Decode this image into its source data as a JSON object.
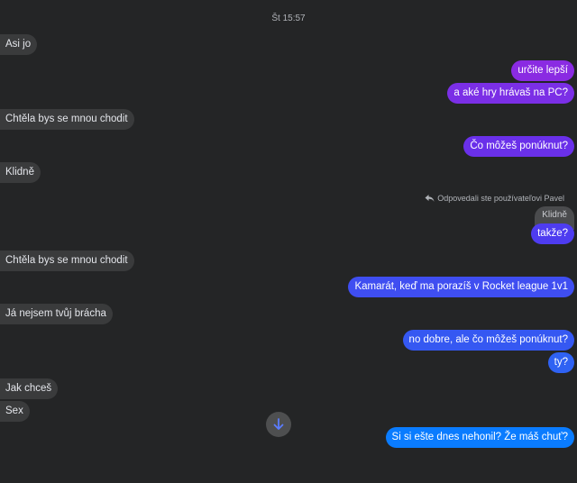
{
  "timestamp": "Št 15:57",
  "messages": [
    {
      "dir": "in",
      "text": "Asi jo"
    },
    {
      "dir": "out",
      "text": "určite lepší",
      "color": "#8a2be2"
    },
    {
      "dir": "out",
      "text": "a aké hry hrávaš na PC?",
      "color": "#7b2fe6"
    },
    {
      "dir": "in",
      "text": "Chtěla bys se mnou chodit"
    },
    {
      "dir": "out",
      "text": "Čo môžeš ponúknut?",
      "color": "#6a30ea"
    },
    {
      "dir": "in",
      "text": "Klidně"
    },
    {
      "dir": "out",
      "text": "takže?",
      "color": "#4e3cf0"
    },
    {
      "dir": "in",
      "text": "Chtěla bys se mnou chodit"
    },
    {
      "dir": "out",
      "text": "Kamarát, keď ma porazíš v Rocket league 1v1",
      "color": "#3f4ef1"
    },
    {
      "dir": "in",
      "text": "Já nejsem tvůj brácha"
    },
    {
      "dir": "out",
      "text": "no dobre, ale čo môžeš ponúknut?",
      "color": "#3558f2"
    },
    {
      "dir": "out",
      "text": "ty?",
      "color": "#2f62f3"
    },
    {
      "dir": "in",
      "text": "Jak chceš"
    },
    {
      "dir": "in",
      "text": "Sex"
    },
    {
      "dir": "out",
      "text": "Si si ešte dnes nehonil? Že máš chuť?",
      "color": "#0a7cff"
    }
  ],
  "reply": {
    "note": "Odpovedali ste používateľovi Pavel",
    "quoted_text": "Klidně"
  },
  "icons": {
    "reply": "reply-arrow-icon",
    "scroll_down": "arrow-down-icon"
  },
  "colors": {
    "background": "#242526",
    "incoming_bubble": "#3a3b3c",
    "scroll_arrow": "#5b7cff"
  }
}
